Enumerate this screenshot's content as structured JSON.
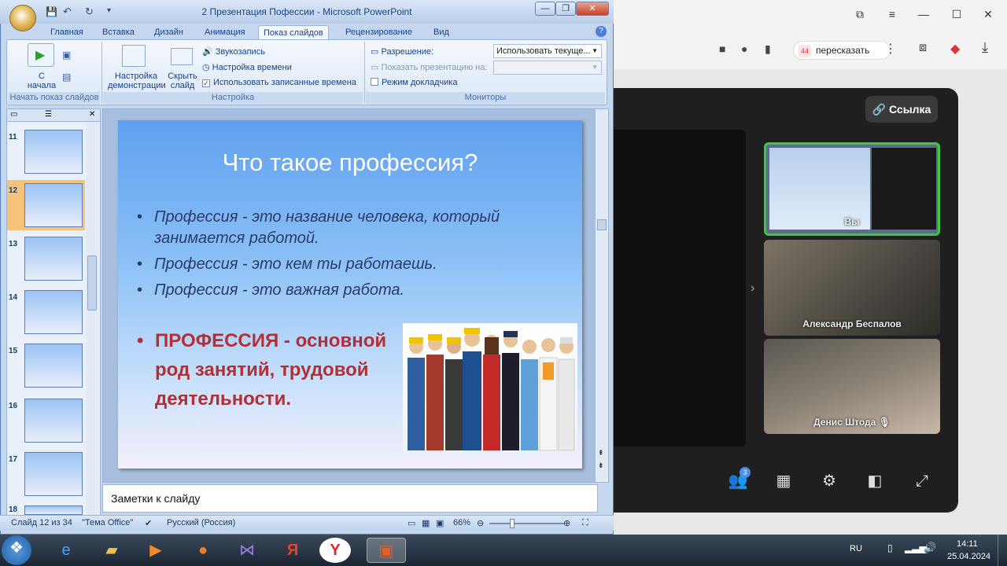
{
  "browser": {
    "translate_label": "пересказать",
    "translate_badge": "44",
    "link_button": "Ссылка"
  },
  "meet": {
    "tiles": [
      {
        "name": "Вы"
      },
      {
        "name": "Александр Беспалов"
      },
      {
        "name": "Денис Штода"
      }
    ],
    "participants_count": "3"
  },
  "ppt": {
    "window_title": "2 Презентация Пофессии - Microsoft PowerPoint",
    "tabs": [
      "Главная",
      "Вставка",
      "Дизайн",
      "Анимация",
      "Показ слайдов",
      "Рецензирование",
      "Вид"
    ],
    "active_tab": "Показ слайдов",
    "ribbon": {
      "from_start": "С начала",
      "setup_show": "Настройка демонстрации",
      "hide_slide": "Скрыть слайд",
      "record_narration": "Звукозапись",
      "rehearse": "Настройка времени",
      "use_timings": "Использовать записанные времена",
      "resolution_label": "Разрешение:",
      "resolution_value": "Использовать текуще...",
      "show_on_label": "Показать презентацию на:",
      "presenter_view": "Режим докладчика",
      "group_start": "Начать показ слайдов",
      "group_setup": "Настройка",
      "group_monitors": "Мониторы"
    },
    "thumbnails": [
      {
        "num": "11"
      },
      {
        "num": "12"
      },
      {
        "num": "13"
      },
      {
        "num": "14"
      },
      {
        "num": "15"
      },
      {
        "num": "16"
      },
      {
        "num": "17"
      },
      {
        "num": "18"
      }
    ],
    "slide": {
      "title": "Что такое профессия?",
      "bullets": [
        "Профессия - это название человека, который занимается работой.",
        "Профессия - это кем ты работаешь.",
        "Профессия - это важная работа."
      ],
      "definition_bold": "ПРОФЕССИЯ",
      "definition_rest": " - основной род занятий, трудовой деятельности."
    },
    "notes_placeholder": "Заметки к слайду",
    "status": {
      "slide_of": "Слайд 12 из 34",
      "theme": "\"Тема Office\"",
      "language": "Русский (Россия)",
      "zoom": "66%"
    }
  },
  "taskbar": {
    "lang": "RU",
    "time": "14:11",
    "date": "25.04.2024"
  },
  "colors": {
    "accent": "#2b579a",
    "slide_red": "#b03036",
    "meet_green": "#3cc93c"
  }
}
